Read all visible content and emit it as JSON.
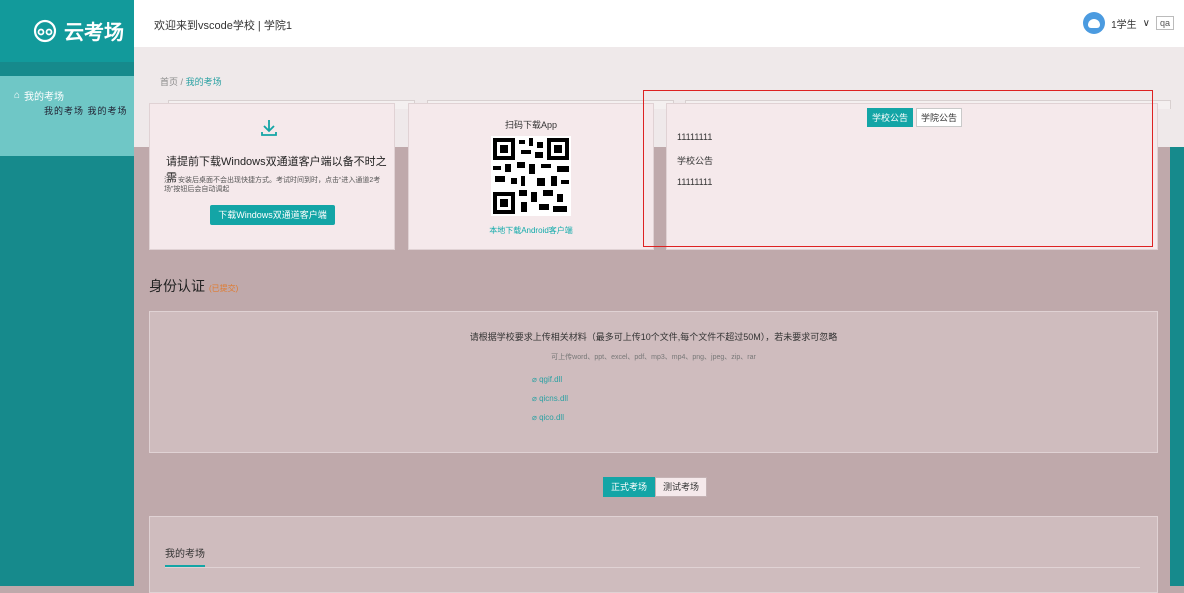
{
  "app": {
    "logo_text": "云考场",
    "welcome": "欢迎来到vscode学校 | 学院1"
  },
  "user": {
    "name": "1学生",
    "dropdown_mark": "∨",
    "extra": "qa"
  },
  "sidebar": {
    "item_label": "我的考场",
    "glitch_text": "我的考场 我的考场"
  },
  "breadcrumb": {
    "home": "首页",
    "separator": "/",
    "current": "我的考场"
  },
  "download": {
    "title": "请提前下载Windows双通道客户端以备不时之需",
    "note": "注：安装后桌面不会出现快捷方式。考试时间到时，点击“进入通道2考场”按钮后会自动调起",
    "button": "下载Windows双通道客户端"
  },
  "qr": {
    "title": "扫码下载App",
    "link": "本地下载Android客户端"
  },
  "notice": {
    "tabs": [
      "学校公告",
      "学院公告"
    ],
    "lines": [
      "11111111",
      "学校公告",
      "11111111"
    ]
  },
  "identity": {
    "title": "身份认证",
    "badge": "(已提交)"
  },
  "upload": {
    "title": "请根据学校要求上传相关材料（最多可上传10个文件,每个文件不超过50M），若未要求可忽略",
    "subtitle": "可上传word、ppt、excel、pdf、mp3、mp4、png、jpeg、zip、rar",
    "files": [
      "qgif.dll",
      "qicns.dll",
      "qico.dll"
    ]
  },
  "exam_tabs": [
    "正式考场",
    "测试考场"
  ],
  "my_exam": {
    "title": "我的考场"
  },
  "colors": {
    "accent": "#13a5a6",
    "sidebar": "#168a8c",
    "frame": "#dd2222"
  }
}
